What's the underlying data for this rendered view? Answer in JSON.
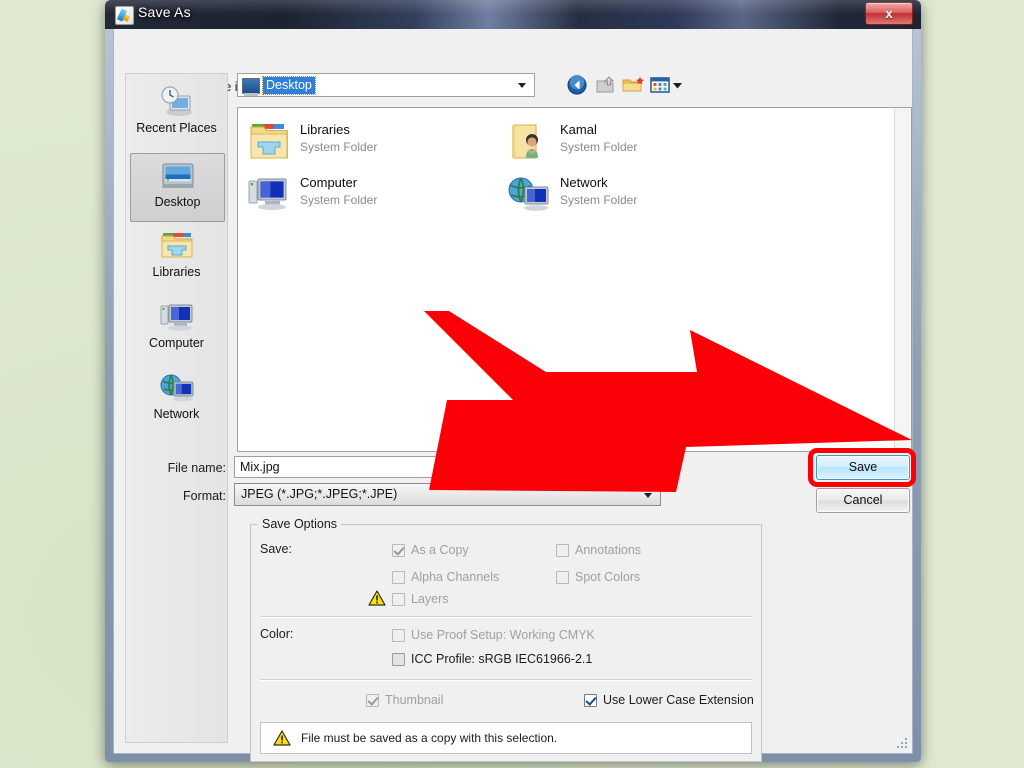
{
  "window": {
    "title": "Save As",
    "title_icon": "photoshop-icon",
    "close_label": "x"
  },
  "toolbar": {
    "savein_label": "Save in:",
    "savein_value": "Desktop",
    "buttons": [
      {
        "name": "back-icon",
        "label": "Back"
      },
      {
        "name": "up-folder-icon",
        "label": "Up One Level"
      },
      {
        "name": "new-folder-icon",
        "label": "Create New Folder"
      },
      {
        "name": "views-icon",
        "label": "View Menu"
      }
    ]
  },
  "places": [
    {
      "label": "Recent Places",
      "icon": "recent-places-icon",
      "selected": false
    },
    {
      "label": "Desktop",
      "icon": "desktop-icon",
      "selected": true
    },
    {
      "label": "Libraries",
      "icon": "libraries-icon",
      "selected": false
    },
    {
      "label": "Computer",
      "icon": "computer-icon",
      "selected": false
    },
    {
      "label": "Network",
      "icon": "network-icon",
      "selected": false
    }
  ],
  "files": [
    {
      "name": "Libraries",
      "type": "System Folder",
      "icon": "libraries-folder-icon"
    },
    {
      "name": "Kamal",
      "type": "System Folder",
      "icon": "user-folder-icon"
    },
    {
      "name": "Computer",
      "type": "System Folder",
      "icon": "computer-icon"
    },
    {
      "name": "Network",
      "type": "System Folder",
      "icon": "network-icon"
    }
  ],
  "fields": {
    "filename_label": "File name:",
    "filename_value": "Mix.jpg",
    "format_label": "Format:",
    "format_value": "JPEG (*.JPG;*.JPEG;*.JPE)"
  },
  "buttons": {
    "save": "Save",
    "cancel": "Cancel"
  },
  "save_options": {
    "group_title": "Save Options",
    "save_label": "Save:",
    "color_label": "Color:",
    "checkboxes": [
      {
        "label": "As a Copy",
        "checked": true,
        "enabled": false
      },
      {
        "label": "Annotations",
        "checked": false,
        "enabled": false
      },
      {
        "label": "Alpha Channels",
        "checked": false,
        "enabled": false
      },
      {
        "label": "Spot Colors",
        "checked": false,
        "enabled": false
      },
      {
        "label": "Layers",
        "checked": false,
        "enabled": false,
        "warning": true
      },
      {
        "label": "Use Proof Setup:  Working CMYK",
        "checked": false,
        "enabled": false
      },
      {
        "label": "ICC Profile:  sRGB IEC61966-2.1",
        "checked": false,
        "enabled": true
      },
      {
        "label": "Thumbnail",
        "checked": true,
        "enabled": false
      },
      {
        "label": "Use Lower Case Extension",
        "checked": true,
        "enabled": true
      }
    ],
    "message": "File must be saved as a copy with this selection."
  },
  "annotation": {
    "arrow_color": "#fb0007",
    "highlight_color": "#fb0007",
    "points_to": "save-button"
  },
  "colors": {
    "desktop_background": "#dfe9d2",
    "dialog_face": "#f0f0f0",
    "accent_selection": "#2f7fd8"
  }
}
